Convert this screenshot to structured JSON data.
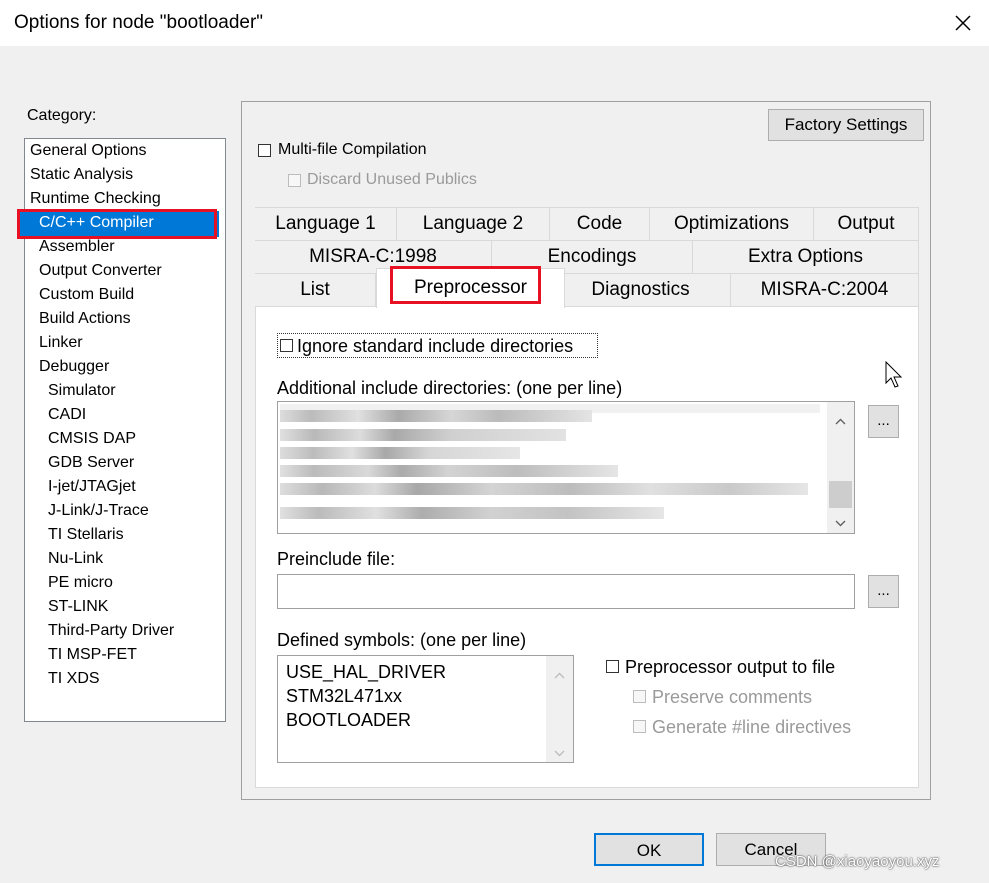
{
  "window": {
    "title": "Options for node \"bootloader\"",
    "close_glyph": "✕"
  },
  "category": {
    "label": "Category:",
    "items": [
      {
        "label": "General Options",
        "indent": 0
      },
      {
        "label": "Static Analysis",
        "indent": 0
      },
      {
        "label": "Runtime Checking",
        "indent": 0
      },
      {
        "label": "C/C++ Compiler",
        "indent": 1,
        "selected": true
      },
      {
        "label": "Assembler",
        "indent": 1
      },
      {
        "label": "Output Converter",
        "indent": 1
      },
      {
        "label": "Custom Build",
        "indent": 1
      },
      {
        "label": "Build Actions",
        "indent": 1
      },
      {
        "label": "Linker",
        "indent": 1
      },
      {
        "label": "Debugger",
        "indent": 1
      },
      {
        "label": "Simulator",
        "indent": 2
      },
      {
        "label": "CADI",
        "indent": 2
      },
      {
        "label": "CMSIS DAP",
        "indent": 2
      },
      {
        "label": "GDB Server",
        "indent": 2
      },
      {
        "label": "I-jet/JTAGjet",
        "indent": 2
      },
      {
        "label": "J-Link/J-Trace",
        "indent": 2
      },
      {
        "label": "TI Stellaris",
        "indent": 2
      },
      {
        "label": "Nu-Link",
        "indent": 2
      },
      {
        "label": "PE micro",
        "indent": 2
      },
      {
        "label": "ST-LINK",
        "indent": 2
      },
      {
        "label": "Third-Party Driver",
        "indent": 2
      },
      {
        "label": "TI MSP-FET",
        "indent": 2
      },
      {
        "label": "TI XDS",
        "indent": 2
      }
    ]
  },
  "panel": {
    "factory_settings": "Factory Settings",
    "multi_file": "Multi-file Compilation",
    "discard_unused": "Discard Unused Publics"
  },
  "tabs": {
    "row1": [
      "Language 1",
      "Language 2",
      "Code",
      "Optimizations",
      "Output"
    ],
    "row2": [
      "MISRA-C:1998",
      "Encodings",
      "Extra Options"
    ],
    "row3": [
      "List",
      "Preprocessor",
      "Diagnostics",
      "MISRA-C:2004"
    ],
    "active": "Preprocessor"
  },
  "preprocessor": {
    "ignore_std": "Ignore standard include directories",
    "include_dirs_label": "Additional include directories: (one per line)",
    "browse": "...",
    "preinclude_label": "Preinclude file:",
    "preinclude_value": "",
    "defined_label": "Defined symbols: (one per line)",
    "symbols": [
      "USE_HAL_DRIVER",
      "STM32L471xx",
      "BOOTLOADER"
    ],
    "pp_output": "Preprocessor output to file",
    "preserve_comments": "Preserve comments",
    "gen_line": "Generate #line directives"
  },
  "footer": {
    "ok": "OK",
    "cancel": "Cancel",
    "watermark": "CSDN @xiaoyaoyou.xyz"
  },
  "colors": {
    "selection": "#0078d7",
    "highlight_box": "#e81123"
  },
  "icons": [
    "close-icon",
    "mouse-cursor-icon",
    "scroll-up-arrow-icon",
    "scroll-down-arrow-icon"
  ]
}
